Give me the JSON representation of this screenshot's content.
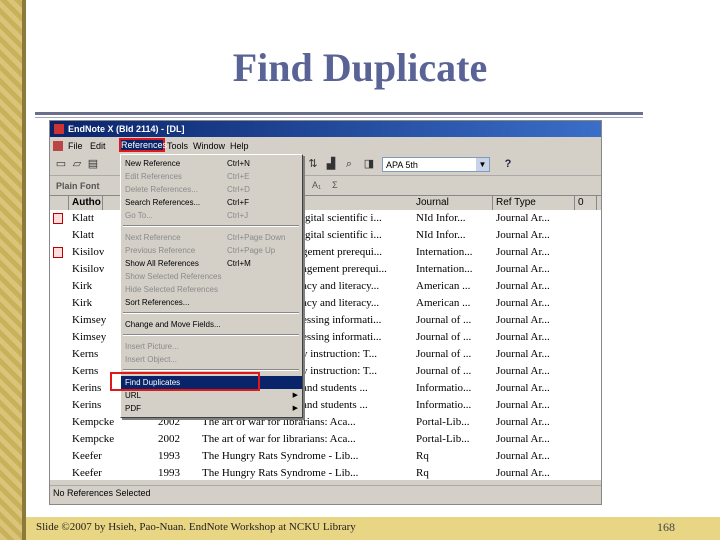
{
  "slide": {
    "title": "Find Duplicate",
    "footer": "Slide ©2007 by Hsieh, Pao-Nuan. EndNote Workshop at NCKU Library",
    "page_number": "168"
  },
  "window": {
    "title": "EndNote X (Bld 2114) - [DL]"
  },
  "menubar": {
    "items": [
      "File",
      "Edit",
      "References",
      "Tools",
      "Window",
      "Help"
    ]
  },
  "toolbar": {
    "style_value": "APA 5th",
    "help_label": "?"
  },
  "formatbar": {
    "font_label": "Plain Font",
    "subscript_label": "A₁",
    "sigma_label": "Σ"
  },
  "list": {
    "headers": [
      "Autho",
      "Journal",
      "Ref Type",
      "0"
    ],
    "rows": [
      {
        "author": "Klatt",
        "year": "",
        "title": "igital scientific i...",
        "journal": "NId Infor...",
        "type": "Journal Ar..."
      },
      {
        "author": "Klatt",
        "year": "",
        "title": "igital scientific i...",
        "journal": "NId Infor...",
        "type": "Journal Ar..."
      },
      {
        "author": "Kisilov",
        "year": "",
        "title": "gement prerequi...",
        "journal": "Internation...",
        "type": "Journal Ar..."
      },
      {
        "author": "Kisilov",
        "year": "",
        "title": "agement prerequi...",
        "journal": "Internation...",
        "type": "Journal Ar..."
      },
      {
        "author": "Kirk",
        "year": "",
        "title": "acy and literacy...",
        "journal": "American ...",
        "type": "Journal Ar..."
      },
      {
        "author": "Kirk",
        "year": "",
        "title": "acy and literacy...",
        "journal": "American ...",
        "type": "Journal Ar..."
      },
      {
        "author": "Kimsey",
        "year": "",
        "title": "essing informati...",
        "journal": "Journal of ...",
        "type": "Journal Ar..."
      },
      {
        "author": "Kimsey",
        "year": "",
        "title": "essing informati...",
        "journal": "Journal of ...",
        "type": "Journal Ar..."
      },
      {
        "author": "Kerns",
        "year": "",
        "title": "y instruction: T...",
        "journal": "Journal of ...",
        "type": "Journal Ar..."
      },
      {
        "author": "Kerns",
        "year": "",
        "title": "y instruction: T...",
        "journal": "Journal of ...",
        "type": "Journal Ar..."
      },
      {
        "author": "Kerins",
        "year": "",
        "title": "and students ...",
        "journal": "Informatio...",
        "type": "Journal Ar..."
      },
      {
        "author": "Kerins",
        "year": "",
        "title": "and students ...",
        "journal": "Informatio...",
        "type": "Journal Ar..."
      },
      {
        "author": "Kempcke",
        "year": "2002",
        "title": "The art of war for librarians: Aca...",
        "journal": "Portal-Lib...",
        "type": "Journal Ar..."
      },
      {
        "author": "Kempcke",
        "year": "2002",
        "title": "The art of war for librarians: Aca...",
        "journal": "Portal-Lib...",
        "type": "Journal Ar..."
      },
      {
        "author": "Keefer",
        "year": "1993",
        "title": "The Hungry Rats Syndrome - Lib...",
        "journal": "Rq",
        "type": "Journal Ar..."
      },
      {
        "author": "Keefer",
        "year": "1993",
        "title": "The Hungry Rats Syndrome - Lib...",
        "journal": "Rq",
        "type": "Journal Ar..."
      }
    ]
  },
  "status_bar": "No References Selected",
  "dropdown": {
    "items": [
      {
        "label": "New Reference",
        "shortcut": "Ctrl+N"
      },
      {
        "label": "Edit References",
        "shortcut": "Ctrl+E"
      },
      {
        "label": "Delete References...",
        "shortcut": "Ctrl+D"
      },
      {
        "label": "Search References...",
        "shortcut": "Ctrl+F"
      },
      {
        "label": "Go To...",
        "shortcut": "Ctrl+J"
      },
      {
        "label": "Next Reference",
        "shortcut": "Ctrl+Page Down"
      },
      {
        "label": "Previous Reference",
        "shortcut": "Ctrl+Page Up"
      },
      {
        "label": "Show All References",
        "shortcut": "Ctrl+M"
      },
      {
        "label": "Show Selected References",
        "shortcut": ""
      },
      {
        "label": "Hide Selected References",
        "shortcut": ""
      },
      {
        "label": "Sort References...",
        "shortcut": ""
      },
      {
        "label": "Change and Move Fields...",
        "shortcut": ""
      },
      {
        "label": "Insert Picture...",
        "shortcut": ""
      },
      {
        "label": "Insert Object...",
        "shortcut": ""
      },
      {
        "label": "Find Duplicates",
        "shortcut": ""
      },
      {
        "label": "URL",
        "shortcut": ""
      },
      {
        "label": "PDF",
        "shortcut": ""
      }
    ]
  }
}
